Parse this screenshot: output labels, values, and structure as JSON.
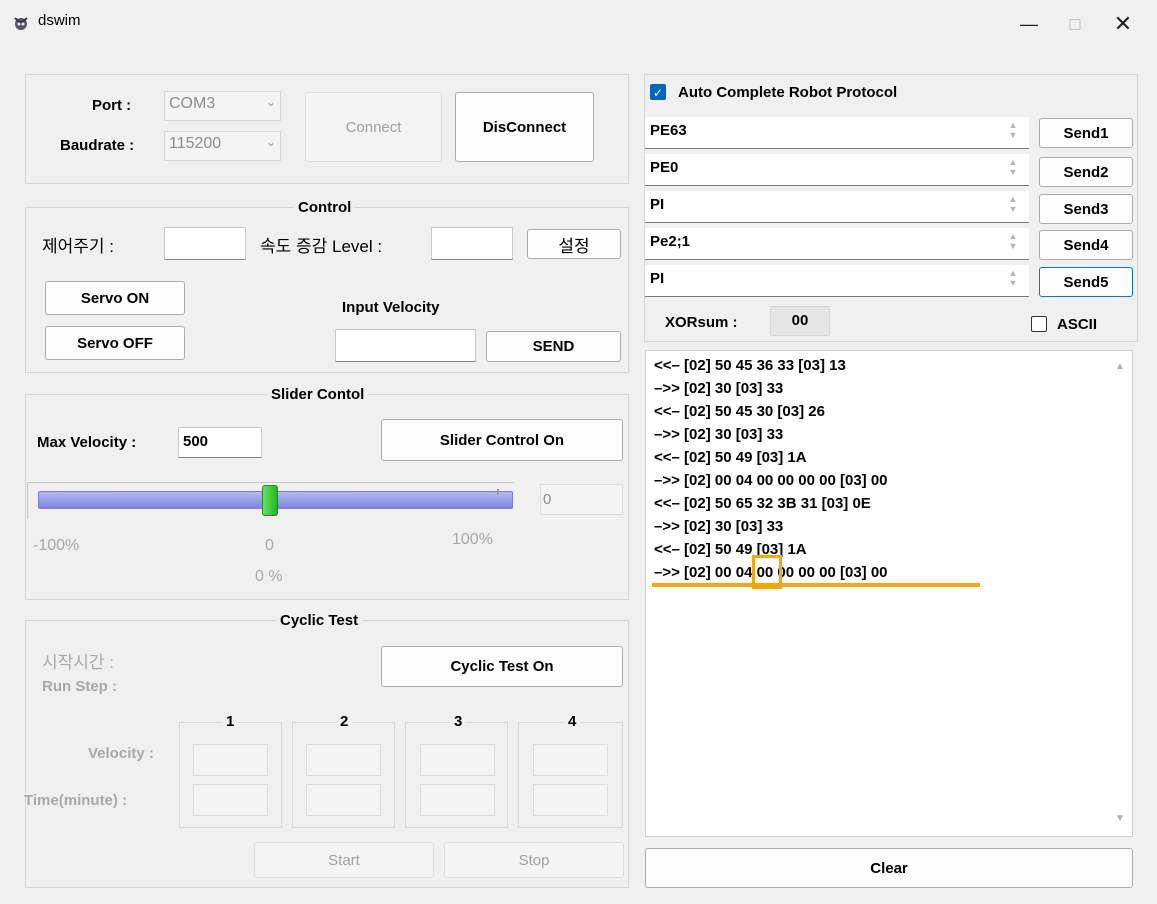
{
  "window": {
    "title": "dswim",
    "min_icon": "minimize-icon",
    "max_icon": "maximize-icon",
    "close_icon": "close-icon"
  },
  "connection": {
    "port_label": "Port :",
    "port_value": "COM3",
    "baud_label": "Baudrate :",
    "baud_value": "115200",
    "connect_label": "Connect",
    "disconnect_label": "DisConnect"
  },
  "control": {
    "title": "Control",
    "period_label": "제어주기 :",
    "speed_level_label": "속도 증감 Level :",
    "set_label": "설정",
    "servo_on": "Servo ON",
    "servo_off": "Servo OFF",
    "input_velocity_label": "Input Velocity",
    "send_label": "SEND"
  },
  "slider": {
    "title": "Slider Contol",
    "max_velocity_label": "Max Velocity :",
    "max_velocity_value": "500",
    "slider_control_on": "Slider Control On",
    "value_box": "0",
    "min_label": "-100%",
    "mid_label": "0",
    "max_label": "100%",
    "percent_label": "0 %",
    "position": 0
  },
  "cyclic": {
    "title": "Cyclic Test",
    "start_time_label": "시작시간 :",
    "run_step_label": "Run Step :",
    "cyclic_test_on": "Cyclic Test On",
    "columns": [
      "1",
      "2",
      "3",
      "4"
    ],
    "velocity_label": "Velocity :",
    "time_label": "Time(minute) :",
    "start_label": "Start",
    "stop_label": "Stop"
  },
  "protocol": {
    "auto_complete_label": "Auto Complete Robot Protocol",
    "auto_complete_checked": true,
    "rows": [
      {
        "value": "PE63",
        "button": "Send1"
      },
      {
        "value": "PE0",
        "button": "Send2"
      },
      {
        "value": "PI",
        "button": "Send3"
      },
      {
        "value": "Pe2;1",
        "button": "Send4"
      },
      {
        "value": "PI",
        "button": "Send5"
      }
    ],
    "xorsum_label": "XORsum :",
    "xorsum_value": "00",
    "ascii_label": "ASCII",
    "ascii_checked": false
  },
  "log": {
    "lines": [
      "<<– [02] 50 45 36 33 [03] 13",
      "–>> [02] 30 [03] 33",
      "<<– [02] 50 45 30 [03] 26",
      "–>> [02] 30 [03] 33",
      "<<– [02] 50 49 [03] 1A",
      "–>> [02] 00 04 00 00 00 00 [03] 00",
      "<<– [02] 50 65 32 3B 31 [03] 0E",
      "–>> [02] 30 [03] 33",
      "<<– [02] 50 49 [03] 1A",
      "–>> [02] 00 04 00 00 00 00 [03] 00"
    ],
    "highlight_color": "#f5a800"
  },
  "clear_label": "Clear",
  "colors": {
    "accent": "#0067c0",
    "slider_track": "#8b8fe6",
    "slider_thumb": "#33cc33",
    "highlight": "#f5a800"
  }
}
